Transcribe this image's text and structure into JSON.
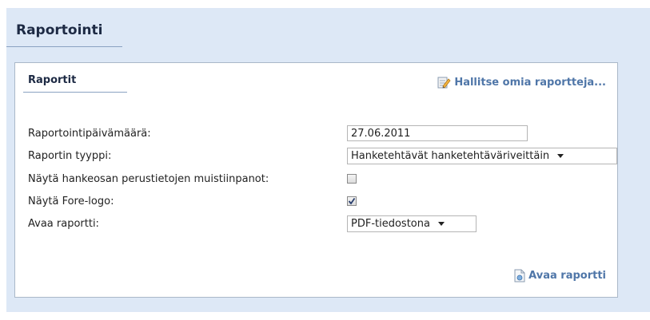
{
  "header": {
    "title": "Raportointi"
  },
  "panel": {
    "title": "Raportit",
    "manage_link": {
      "label": "Hallitse omia raportteja...",
      "icon": "edit-document-icon"
    },
    "fields": {
      "report_date": {
        "label": "Raportointipäivämäärä:",
        "value": "27.06.2011"
      },
      "report_type": {
        "label": "Raportin tyyppi:",
        "selected": "Hanketehtävät hanketehtäväriveittäin"
      },
      "show_notes": {
        "label": "Näytä hankeosan perustietojen muistiinpanot:",
        "checked": false
      },
      "show_logo": {
        "label": "Näytä Fore-logo:",
        "checked": true
      },
      "open_report_as": {
        "label": "Avaa raportti:",
        "selected": "PDF-tiedostona"
      }
    },
    "open_button": {
      "label": "Avaa raportti",
      "icon": "open-document-icon"
    }
  },
  "colors": {
    "background": "#dde8f6",
    "link": "#4f76a8",
    "title": "#1d2a44"
  }
}
